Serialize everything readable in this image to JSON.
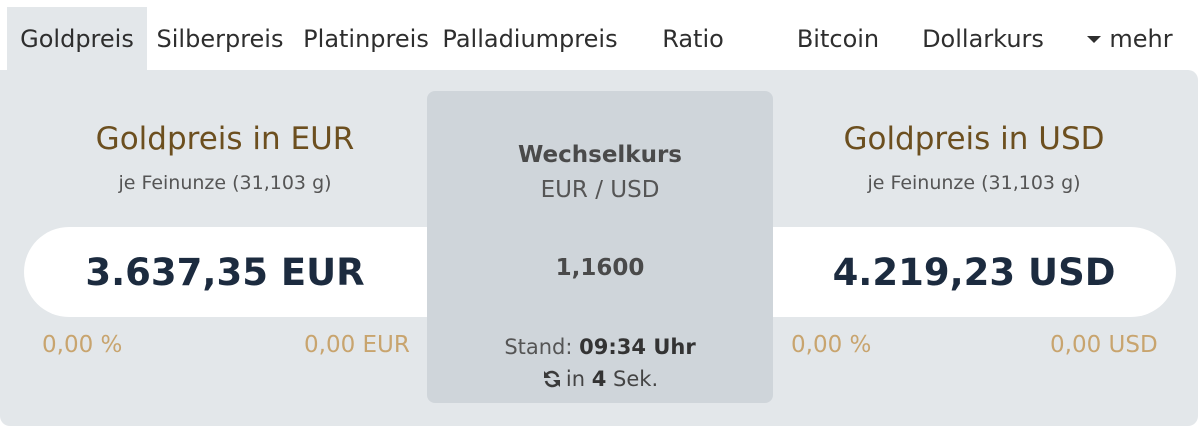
{
  "tabs": [
    {
      "label": "Goldpreis",
      "active": true
    },
    {
      "label": "Silberpreis"
    },
    {
      "label": "Platinpreis"
    },
    {
      "label": "Palladiumpreis"
    },
    {
      "label": "Ratio"
    },
    {
      "label": "Bitcoin"
    },
    {
      "label": "Dollarkurs"
    },
    {
      "label": "mehr",
      "icon": "caret-down-icon"
    }
  ],
  "eur": {
    "title": "Goldpreis in EUR",
    "subtitle": "je Feinunze (31,103 g)",
    "price": "3.637,35 EUR",
    "change_pct": "0,00 %",
    "change_abs": "0,00 EUR"
  },
  "usd": {
    "title": "Goldpreis in USD",
    "subtitle": "je Feinunze (31,103 g)",
    "price": "4.219,23 USD",
    "change_pct": "0,00 %",
    "change_abs": "0,00 USD"
  },
  "fx": {
    "title": "Wechselkurs",
    "pair": "EUR / USD",
    "rate": "1,1600",
    "stand_label": "Stand:",
    "stand_time": "09:34 Uhr",
    "refresh_prefix": "in",
    "refresh_seconds": "4",
    "refresh_suffix": "Sek."
  },
  "colors": {
    "accent_title": "#6c4f1f",
    "change": "#c8a46e",
    "price": "#1c2b3f",
    "panel": "#e3e7ea",
    "fx_box": "#cfd5da"
  }
}
